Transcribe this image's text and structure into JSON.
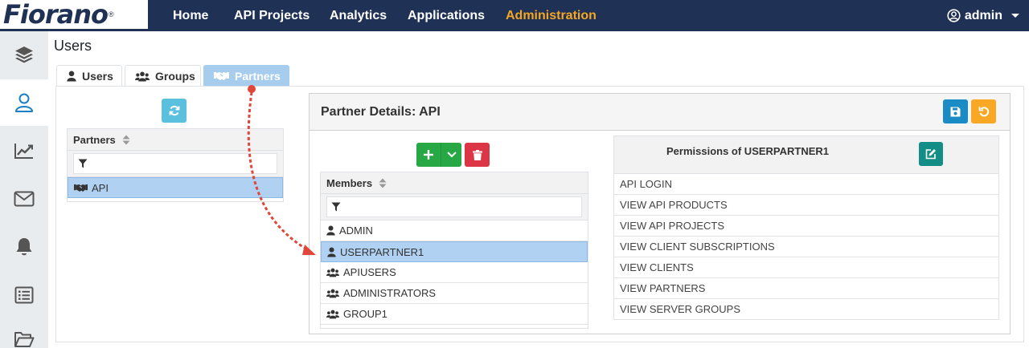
{
  "brand": {
    "logo_text": "Fiorano",
    "registered": "®"
  },
  "nav": {
    "items": [
      "Home",
      "API Projects",
      "Analytics",
      "Applications",
      "Administration"
    ],
    "active": "Administration",
    "user": "admin"
  },
  "sidebar": {
    "items": [
      "api-layers",
      "users",
      "analytics",
      "messages",
      "alerts",
      "lists",
      "folders"
    ],
    "active": "users"
  },
  "page": {
    "title": "Users"
  },
  "tabs": [
    {
      "label": "Users",
      "icon": "user-icon"
    },
    {
      "label": "Groups",
      "icon": "users-icon"
    },
    {
      "label": "Partners",
      "icon": "handshake-icon",
      "active": true
    }
  ],
  "partners_list": {
    "header": "Partners",
    "rows": [
      "API"
    ],
    "selected": "API"
  },
  "partner_details": {
    "title": "Partner Details: API",
    "members": {
      "header": "Members",
      "rows": [
        {
          "label": "ADMIN",
          "type": "user"
        },
        {
          "label": "USERPARTNER1",
          "type": "user",
          "selected": true
        },
        {
          "label": "APIUSERS",
          "type": "group"
        },
        {
          "label": "ADMINISTRATORS",
          "type": "group"
        },
        {
          "label": "GROUP1",
          "type": "group"
        }
      ]
    },
    "permissions": {
      "title": "Permissions of USERPARTNER1",
      "rows": [
        "API LOGIN",
        "VIEW API PRODUCTS",
        "VIEW API PROJECTS",
        "VIEW CLIENT SUBSCRIPTIONS",
        "VIEW CLIENTS",
        "VIEW PARTNERS",
        "VIEW SERVER GROUPS"
      ]
    }
  },
  "colors": {
    "navbar": "#1f3154",
    "nav_active": "#f5a623",
    "tab_active": "#a7cdee",
    "refresh_button": "#5bc0de",
    "add_button": "#28a745",
    "delete_button": "#dc3545",
    "save_button": "#1b8bc5",
    "reset_button": "#f9a825",
    "edit_button": "#138d86",
    "selected_row": "#b0d1f1",
    "annotation_arrow": "#e0463a"
  }
}
